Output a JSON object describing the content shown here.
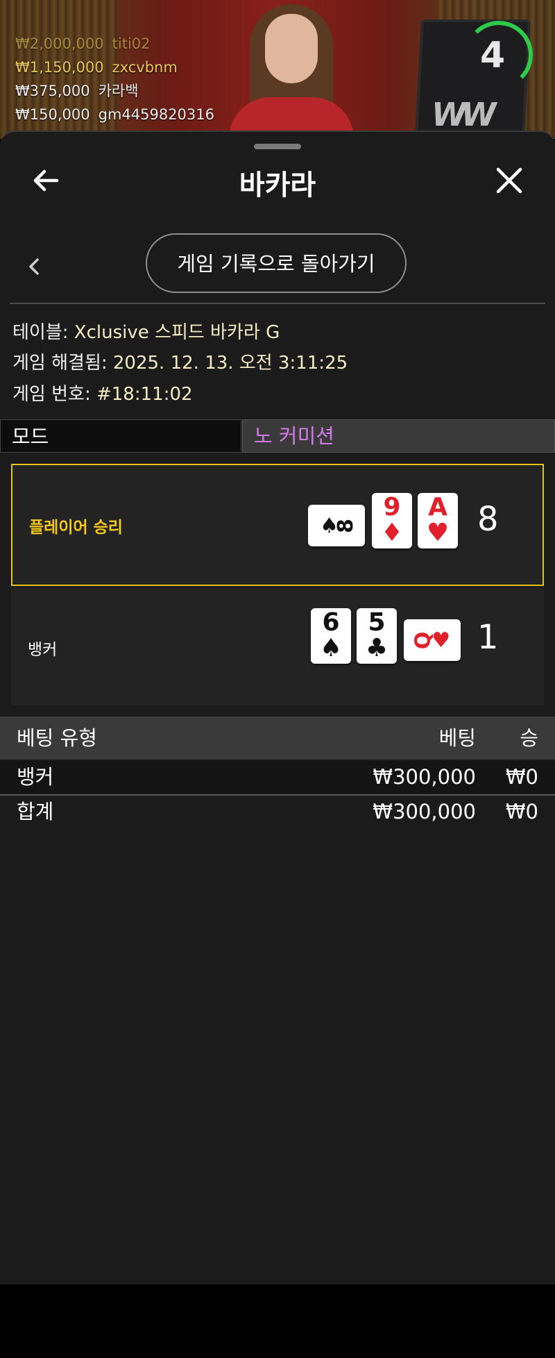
{
  "video": {
    "winners": [
      {
        "amount": "₩2,000,000",
        "name": "titi02"
      },
      {
        "amount": "₩1,150,000",
        "name": "zxcvbnm"
      },
      {
        "amount": "₩375,000",
        "name": "카라백"
      },
      {
        "amount": "₩150,000",
        "name": "gm4459820316"
      }
    ],
    "timer": "4"
  },
  "header": {
    "title": "바카라",
    "back_icon": "arrow-left-icon",
    "close_icon": "close-icon"
  },
  "history_button": "게임 기록으로 돌아가기",
  "info": {
    "table_label": "테이블:",
    "table_value": "Xclusive 스피드 바카라 G",
    "resolved_label": "게임 해결됨:",
    "resolved_value": "2025. 12. 13. 오전 3:11:25",
    "number_label": "게임 번호:",
    "number_value": "#18:11:02"
  },
  "mode": {
    "label": "모드",
    "value": "노 커미션",
    "value_color": "#d47ae8"
  },
  "player": {
    "label": "플레이어 승리",
    "score": "8",
    "cards": [
      {
        "rank": "8",
        "suit": "♠",
        "color": "black",
        "sideways": true
      },
      {
        "rank": "9",
        "suit": "♦",
        "color": "red",
        "sideways": false
      },
      {
        "rank": "A",
        "suit": "♥",
        "color": "red",
        "sideways": false
      }
    ]
  },
  "banker": {
    "label": "뱅커",
    "score": "1",
    "cards": [
      {
        "rank": "6",
        "suit": "♠",
        "color": "black",
        "sideways": false
      },
      {
        "rank": "5",
        "suit": "♣",
        "color": "black",
        "sideways": false
      },
      {
        "rank": "Q",
        "suit": "♥",
        "color": "red",
        "sideways": true
      }
    ]
  },
  "bets": {
    "headers": {
      "type": "베팅 유형",
      "bet": "베팅",
      "win": "승"
    },
    "rows": [
      {
        "type": "뱅커",
        "bet": "₩300,000",
        "win": "₩0"
      }
    ],
    "total": {
      "type": "합계",
      "bet": "₩300,000",
      "win": "₩0"
    }
  },
  "colors": {
    "accent_gold": "#e6c21a",
    "red_suit": "#e0202a",
    "background": "#1b1b1b"
  }
}
